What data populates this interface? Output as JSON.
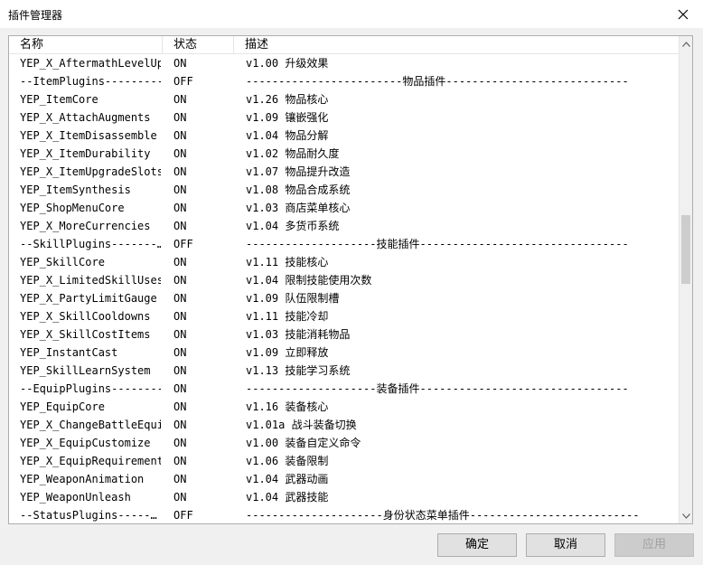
{
  "window": {
    "title": "插件管理器"
  },
  "columns": [
    "名称",
    "状态",
    "描述"
  ],
  "rows": [
    [
      "YEP_X_AftermathLevelUp",
      "ON",
      "v1.00 升级效果"
    ],
    [
      "--ItemPlugins----------",
      "OFF",
      "------------------------物品插件----------------------------"
    ],
    [
      "YEP_ItemCore",
      "ON",
      "v1.26 物品核心"
    ],
    [
      "YEP_X_AttachAugments",
      "ON",
      "v1.09 镶嵌强化"
    ],
    [
      "YEP_X_ItemDisassemble",
      "ON",
      "v1.04 物品分解"
    ],
    [
      "YEP_X_ItemDurability",
      "ON",
      "v1.02 物品耐久度"
    ],
    [
      "YEP_X_ItemUpgradeSlots",
      "ON",
      "v1.07 物品提升改造"
    ],
    [
      "YEP_ItemSynthesis",
      "ON",
      "v1.08 物品合成系统"
    ],
    [
      "YEP_ShopMenuCore",
      "ON",
      "v1.03 商店菜单核心"
    ],
    [
      "YEP_X_MoreCurrencies",
      "ON",
      "v1.04 多货币系统"
    ],
    [
      "--SkillPlugins-------…",
      "OFF",
      "--------------------技能插件--------------------------------"
    ],
    [
      "YEP_SkillCore",
      "ON",
      "v1.11 技能核心"
    ],
    [
      "YEP_X_LimitedSkillUses",
      "ON",
      "v1.04 限制技能使用次数"
    ],
    [
      "YEP_X_PartyLimitGauge",
      "ON",
      "v1.09 队伍限制槽"
    ],
    [
      "YEP_X_SkillCooldowns",
      "ON",
      "v1.11 技能冷却"
    ],
    [
      "YEP_X_SkillCostItems",
      "ON",
      "v1.03 技能消耗物品"
    ],
    [
      "YEP_InstantCast",
      "ON",
      "v1.09 立即释放"
    ],
    [
      "YEP_SkillLearnSystem",
      "ON",
      "v1.13 技能学习系统"
    ],
    [
      "--EquipPlugins---------",
      "ON",
      "--------------------装备插件--------------------------------"
    ],
    [
      "YEP_EquipCore",
      "ON",
      "v1.16 装备核心"
    ],
    [
      "YEP_X_ChangeBattleEquip",
      "ON",
      "v1.01a 战斗装备切换"
    ],
    [
      "YEP_X_EquipCustomize",
      "ON",
      "v1.00 装备自定义命令"
    ],
    [
      "YEP_X_EquipRequirements",
      "ON",
      "v1.06 装备限制"
    ],
    [
      "YEP_WeaponAnimation",
      "ON",
      "v1.04 武器动画"
    ],
    [
      "YEP_WeaponUnleash",
      "ON",
      "v1.04 武器技能"
    ],
    [
      "--StatusPlugins-----…",
      "OFF",
      "---------------------身份状态菜单插件--------------------------"
    ]
  ],
  "buttons": {
    "ok": "确定",
    "cancel": "取消",
    "apply": "应用"
  }
}
